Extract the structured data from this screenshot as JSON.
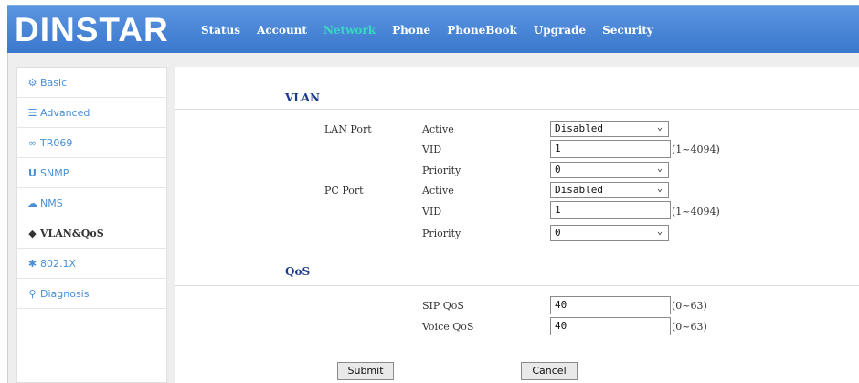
{
  "header": {
    "logo": "DINSTAR",
    "nav": [
      "Status",
      "Account",
      "Network",
      "Phone",
      "PhoneBook",
      "Upgrade",
      "Security"
    ],
    "active_nav": "Network",
    "active_color": "#38d8c0"
  },
  "sidebar": {
    "items": [
      {
        "label": "Basic",
        "icon": "gear-icon"
      },
      {
        "label": "Advanced",
        "icon": "list-icon"
      },
      {
        "label": "TR069",
        "icon": "link-icon"
      },
      {
        "label": "SNMP",
        "icon": "u-icon"
      },
      {
        "label": "NMS",
        "icon": "cloud-icon"
      },
      {
        "label": "VLAN&QoS",
        "icon": "diamond-icon"
      },
      {
        "label": "802.1X",
        "icon": "asterisk-icon"
      },
      {
        "label": "Diagnosis",
        "icon": "magnifier-icon"
      }
    ],
    "active": "VLAN&QoS"
  },
  "vlan": {
    "title": "VLAN",
    "lan_port": {
      "label": "LAN Port",
      "active_label": "Active",
      "active_value": "Disabled",
      "vid_label": "VID",
      "vid_value": "1",
      "vid_hint": "(1~4094)",
      "priority_label": "Priority",
      "priority_value": "0"
    },
    "pc_port": {
      "label": "PC Port",
      "active_label": "Active",
      "active_value": "Disabled",
      "vid_label": "VID",
      "vid_value": "1",
      "vid_hint": "(1~4094)",
      "priority_label": "Priority",
      "priority_value": "0"
    }
  },
  "qos": {
    "title": "QoS",
    "sip_label": "SIP QoS",
    "sip_value": "40",
    "sip_hint": "(0~63)",
    "voice_label": "Voice QoS",
    "voice_value": "40",
    "voice_hint": "(0~63)"
  },
  "actions": {
    "submit": "Submit",
    "cancel": "Cancel"
  }
}
